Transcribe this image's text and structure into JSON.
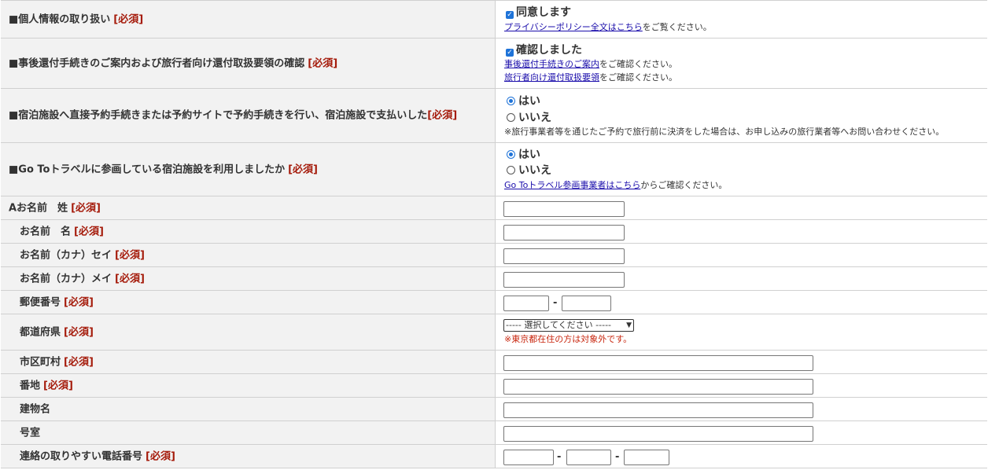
{
  "required_tag": "[必須]",
  "rows": {
    "privacy": {
      "label": "■個人情報の取り扱い",
      "checkbox_label": "同意します",
      "link_text": "プライバシーポリシー全文はこちら",
      "link_suffix": "をご覧ください。"
    },
    "refund_guide": {
      "label": "■事後還付手続きのご案内および旅行者向け還付取扱要領の確認",
      "checkbox_label": "確認しました",
      "link1_text": "事後還付手続きのご案内",
      "link1_suffix": "をご確認ください。",
      "link2_text": "旅行者向け還付取扱要領",
      "link2_suffix": "をご確認ください。"
    },
    "direct_booking": {
      "label": "■宿泊施設へ直接予約手続きまたは予約サイトで予約手続きを行い、宿泊施設で支払いした",
      "option_yes": "はい",
      "option_no": "いいえ",
      "selected": "はい",
      "note": "※旅行事業者等を通じたご予約で旅行前に決済をした場合は、お申し込みの旅行業者等へお問い合わせください。"
    },
    "goto_facility": {
      "label": "■Go Toトラベルに参画している宿泊施設を利用しましたか",
      "option_yes": "はい",
      "option_no": "いいえ",
      "selected": "はい",
      "link_text": "Go Toトラベル参画事業者はこちら",
      "link_suffix": "からご確認ください。"
    },
    "last_name": {
      "label": "Aお名前　姓",
      "value": ""
    },
    "first_name": {
      "label": "お名前　名",
      "value": ""
    },
    "last_name_kana": {
      "label": "お名前（カナ）セイ",
      "value": ""
    },
    "first_name_kana": {
      "label": "お名前（カナ）メイ",
      "value": ""
    },
    "postal_code": {
      "label": "郵便番号",
      "part1": "",
      "part2": "",
      "separator": "-"
    },
    "prefecture": {
      "label": "都道府県",
      "selected_option": "----- 選択してください -----",
      "note": "※東京都在住の方は対象外です。"
    },
    "city": {
      "label": "市区町村",
      "value": ""
    },
    "street": {
      "label": "番地",
      "value": ""
    },
    "building": {
      "label": "建物名",
      "value": ""
    },
    "room": {
      "label": "号室",
      "value": ""
    },
    "phone": {
      "label": "連絡の取りやすい電話番号",
      "part1": "",
      "part2": "",
      "part3": "",
      "separator": "-"
    }
  },
  "colors": {
    "label_background": "#f2f2f2",
    "border": "#d0d0d0",
    "required_red": "#a51b0b",
    "note_red": "#c8250d",
    "link": "#1a0dab",
    "accent_blue": "#1e73d8"
  }
}
